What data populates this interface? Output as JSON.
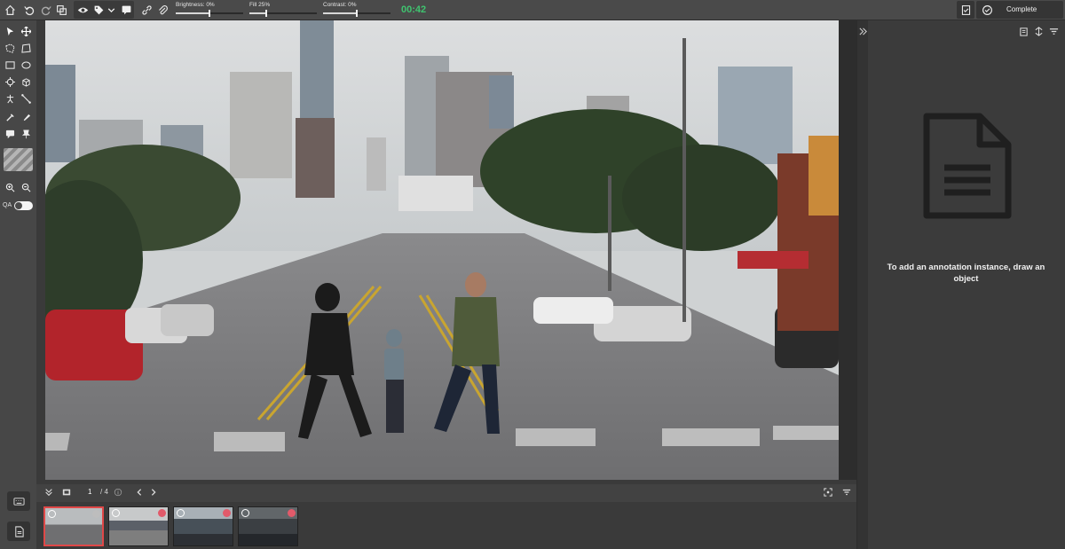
{
  "toolbar": {
    "brightness": {
      "label": "Brightness: 0%",
      "value_pct": 50
    },
    "fill": {
      "label": "Fill 25%",
      "value_pct": 25
    },
    "contrast": {
      "label": "Contrast: 0%",
      "value_pct": 50
    },
    "timer": "00:42",
    "complete_label": "Complete"
  },
  "navbar": {
    "page_current": "1",
    "page_total": "/ 4"
  },
  "filmstrip": {
    "count": 4,
    "active_index": 0
  },
  "right_panel": {
    "empty_message": "To add an annotation instance, draw an object"
  },
  "colors": {
    "accent_green": "#3fc36f",
    "active_thumb_border": "#e04848",
    "panel_bg": "#3b3b3b"
  },
  "icons": {
    "top_left": [
      "home-icon",
      "undo-icon",
      "redo-icon",
      "copy-icon"
    ],
    "view": [
      "eye-icon",
      "tag-icon",
      "chevron-down-icon",
      "comment-icon"
    ],
    "link": [
      "link-icon",
      "paperclip-icon"
    ],
    "complete": [
      "checklist-icon",
      "check-circle-icon"
    ]
  }
}
